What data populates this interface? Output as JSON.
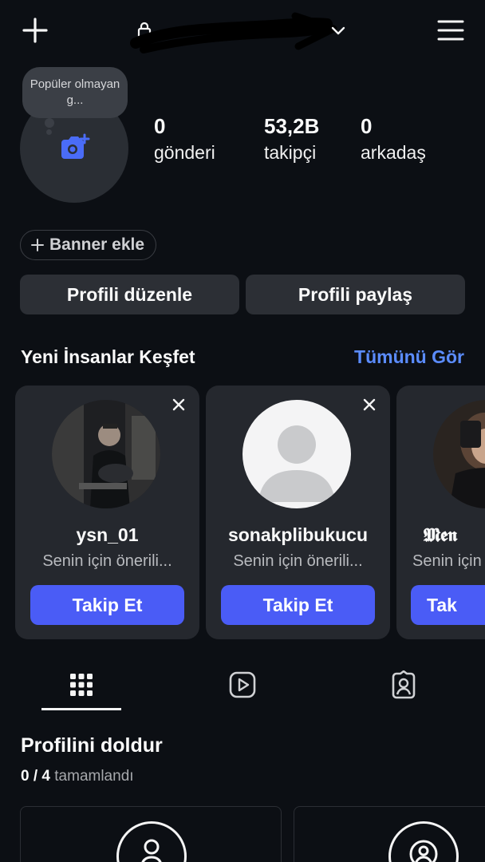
{
  "header": {
    "username": "",
    "add_icon": "plus-icon",
    "menu_icon": "hamburger-icon"
  },
  "profile": {
    "note_bubble": "Popüler olmayan g...",
    "stats": [
      {
        "value": "0",
        "label": "gönderi"
      },
      {
        "value": "53,2B",
        "label": "takipçi"
      },
      {
        "value": "0",
        "label": "arkadaş"
      }
    ],
    "banner_button": "Banner ekle",
    "edit_button": "Profili düzenle",
    "share_button": "Profili paylaş"
  },
  "discover": {
    "title": "Yeni İnsanlar Keşfet",
    "see_all": "Tümünü Gör",
    "cards": [
      {
        "username": "ysn_01",
        "subtitle": "Senin için önerili...",
        "button": "Takip Et"
      },
      {
        "username": "sonakplibukucu",
        "subtitle": "Senin için önerili...",
        "button": "Takip Et"
      },
      {
        "username": "𝕸𝖊𝖓",
        "subtitle": "Senin için",
        "button": "Tak"
      }
    ]
  },
  "tabs": [
    "grid-icon",
    "reels-icon",
    "tagged-icon"
  ],
  "complete_profile": {
    "title": "Profilini doldur",
    "progress": "0 / 4",
    "progress_label": "tamamlandı"
  },
  "colors": {
    "background": "#0c0f14",
    "accent": "#4a5cf6",
    "link": "#5b8cff"
  }
}
